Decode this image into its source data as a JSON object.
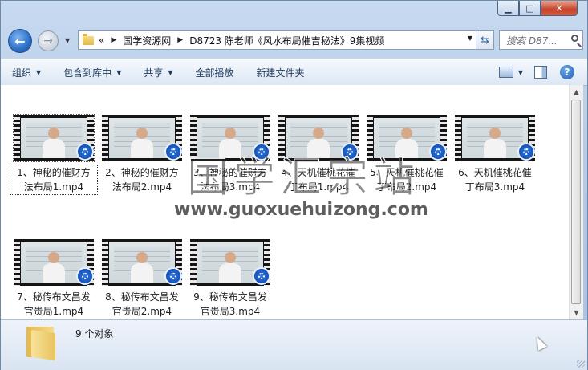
{
  "window": {
    "controls": {
      "minimize": "▁",
      "maximize": "□",
      "close": "✕"
    }
  },
  "nav": {
    "back_icon": "back-arrow-icon",
    "forward_icon": "forward-arrow-icon",
    "breadcrumb_prefix": "«",
    "breadcrumbs": [
      "国学资源网",
      "D8723 陈老师《风水布局催吉秘法》9集视频"
    ],
    "search_placeholder": "搜索 D87..."
  },
  "toolbar": {
    "organize": "组织",
    "include_in_library": "包含到库中",
    "share": "共享",
    "play_all": "全部播放",
    "new_folder": "新建文件夹"
  },
  "files": [
    {
      "line1": "1、神秘的催财方",
      "line2": "法布局1.mp4",
      "selected": true
    },
    {
      "line1": "2、神秘的催财方",
      "line2": "法布局2.mp4"
    },
    {
      "line1": "3、神秘的催财方",
      "line2": "法布局3.mp4"
    },
    {
      "line1": "4、天机催桃花催",
      "line2": "丁布局1.mp4"
    },
    {
      "line1": "5、天机催桃花催",
      "line2": "丁布局2.mp4"
    },
    {
      "line1": "6、天机催桃花催",
      "line2": "丁布局3.mp4"
    },
    {
      "line1": "7、秘传布文昌发",
      "line2": "官贵局1.mp4"
    },
    {
      "line1": "8、秘传布文昌发",
      "line2": "官贵局2.mp4"
    },
    {
      "line1": "9、秘传布文昌发",
      "line2": "官贵局3.mp4"
    }
  ],
  "watermark": {
    "text": "国学汇宗站",
    "url": "www.guoxuehuizong.com"
  },
  "status": {
    "count": "9 个对象"
  }
}
